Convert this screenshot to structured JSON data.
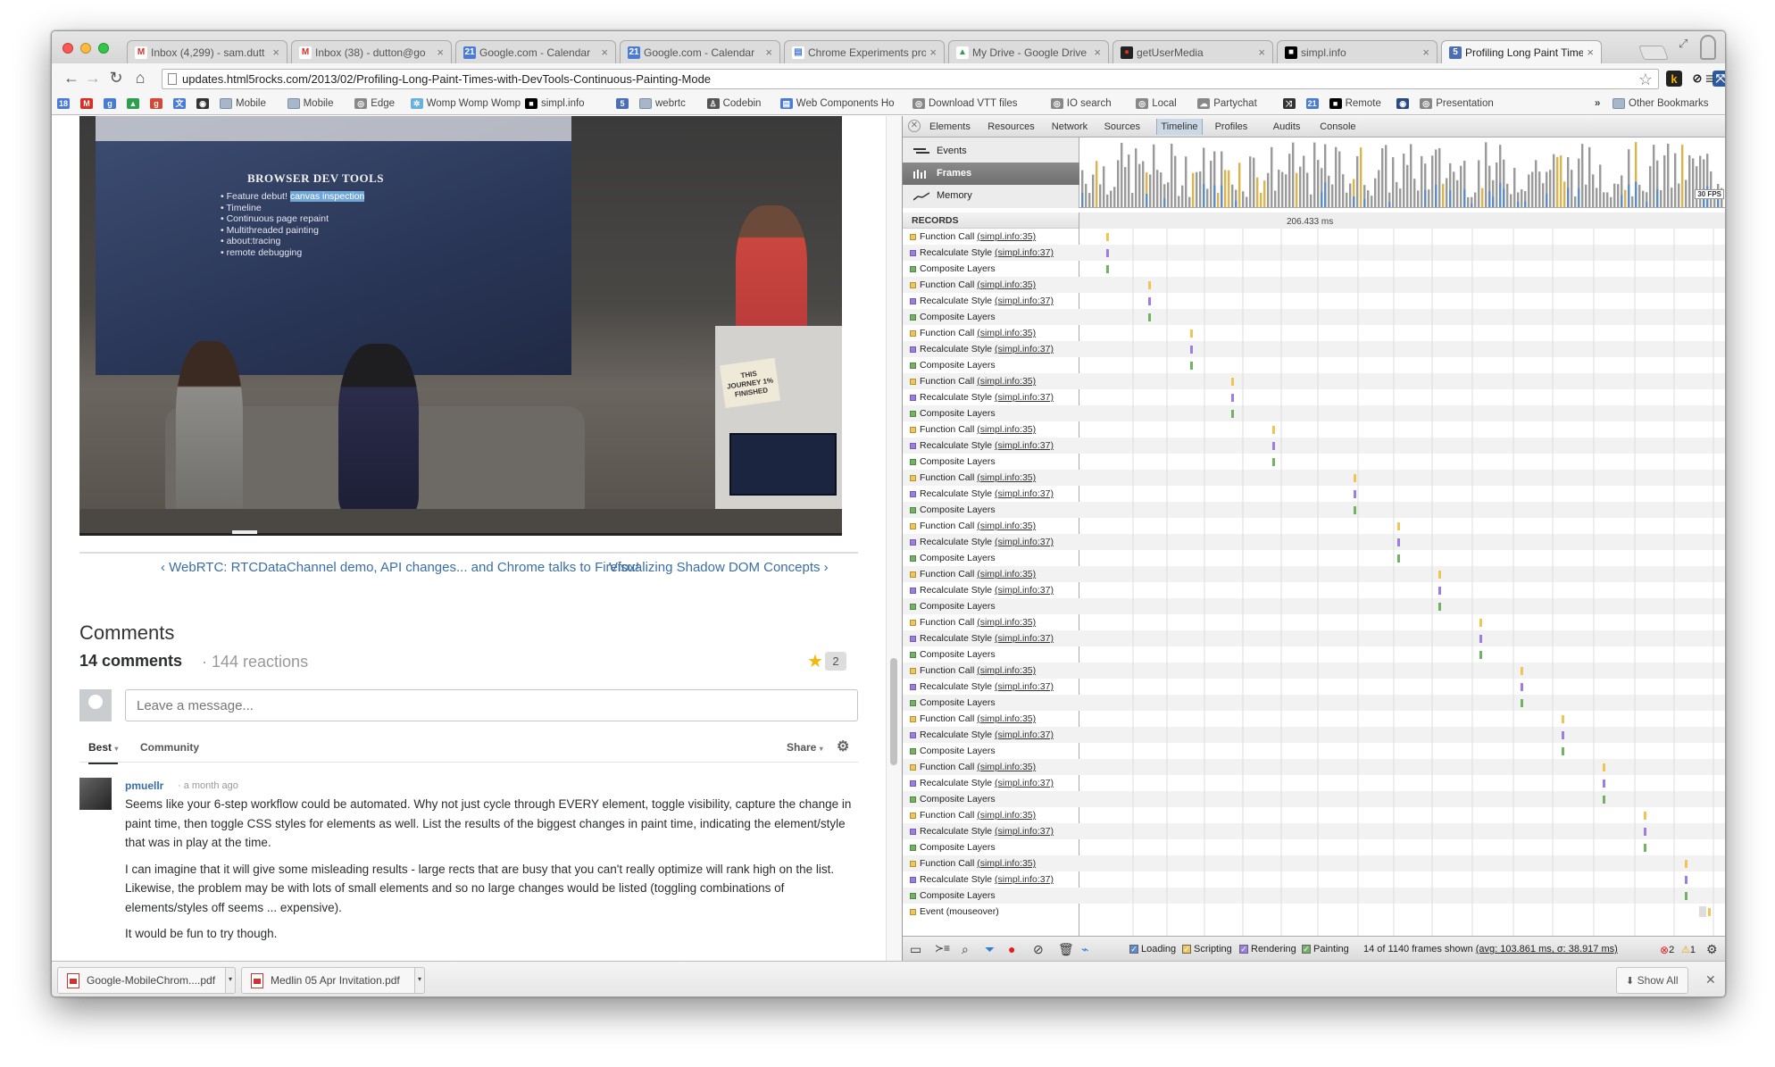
{
  "window": {
    "lights": [
      "#fc5753",
      "#fdbc40",
      "#33c748"
    ]
  },
  "tabs": [
    {
      "title": "Inbox (4,299) - sam.dutt",
      "icon": "gmail-icon",
      "fav": "M",
      "fav_color": "#d93025",
      "fav_bg": "#fff"
    },
    {
      "title": "Inbox (38) - dutton@go",
      "icon": "gmail-icon",
      "fav": "M",
      "fav_color": "#d93025",
      "fav_bg": "#fff"
    },
    {
      "title": "Google.com - Calendar",
      "icon": "calendar-icon",
      "fav": "21",
      "fav_color": "#fff",
      "fav_bg": "#4a7bd6"
    },
    {
      "title": "Google.com - Calendar",
      "icon": "calendar-icon",
      "fav": "21",
      "fav_color": "#fff",
      "fav_bg": "#4a7bd6"
    },
    {
      "title": "Chrome Experiments pro",
      "icon": "page-icon",
      "fav": "▤",
      "fav_color": "#4a7bd6",
      "fav_bg": "#fff"
    },
    {
      "title": "My Drive - Google Drive",
      "icon": "drive-icon",
      "fav": "▲",
      "fav_color": "#2e9e4f",
      "fav_bg": "#fff"
    },
    {
      "title": "getUserMedia",
      "icon": "record-icon",
      "fav": "●",
      "fav_color": "#d93025",
      "fav_bg": "#222"
    },
    {
      "title": "simpl.info",
      "icon": "simpl-icon",
      "fav": "■",
      "fav_color": "#fff",
      "fav_bg": "#000"
    },
    {
      "title": "Profiling Long Paint Time",
      "icon": "html5-icon",
      "fav": "5",
      "fav_color": "#fff",
      "fav_bg": "#4a6fb5"
    }
  ],
  "toolbar": {
    "url_host": "updates.html5rocks.com",
    "url_path": "/2013/02/Profiling-Long-Paint-Times-with-DevTools-Continuous-Painting-Mode"
  },
  "bookmarks": {
    "items": [
      {
        "label": "",
        "icon": "calendar-icon",
        "color": "#4a7bd6",
        "glyph": "18"
      },
      {
        "label": "",
        "icon": "gmail-icon",
        "color": "#d93025",
        "glyph": "M"
      },
      {
        "label": "",
        "icon": "google-icon",
        "color": "#4a7bd6",
        "glyph": "g"
      },
      {
        "label": "",
        "icon": "drive-icon",
        "color": "#2e9e4f",
        "glyph": "▲"
      },
      {
        "label": "",
        "icon": "gplus-icon",
        "color": "#d34836",
        "glyph": "g"
      },
      {
        "label": "",
        "icon": "translate-icon",
        "color": "#4a7bd6",
        "glyph": "文"
      },
      {
        "label": "",
        "icon": "globe-icon",
        "color": "#333",
        "glyph": "◉"
      },
      {
        "label": "Mobile",
        "icon": "folder-icon",
        "color": "#a7b7c9",
        "glyph": ""
      },
      {
        "label": "Mobile",
        "icon": "folder-icon",
        "color": "#a7b7c9",
        "glyph": ""
      },
      {
        "label": "Edge",
        "icon": "globe-icon",
        "color": "#888",
        "glyph": "◎"
      },
      {
        "label": "Womp Womp Womp",
        "icon": "gear-icon",
        "color": "#6ab0de",
        "glyph": "✲"
      },
      {
        "label": "simpl.info",
        "icon": "simpl-icon",
        "color": "#000",
        "glyph": "■"
      },
      {
        "label": "",
        "icon": "html5-icon",
        "color": "#4a6fb5",
        "glyph": "5"
      },
      {
        "label": "webrtc",
        "icon": "folder-icon",
        "color": "#a7b7c9",
        "glyph": ""
      },
      {
        "label": "Codebin",
        "icon": "person-icon",
        "color": "#555",
        "glyph": "♙"
      },
      {
        "label": "Web Components Ho",
        "icon": "page-icon",
        "color": "#4a7bd6",
        "glyph": "▤"
      },
      {
        "label": "Download VTT files",
        "icon": "globe-icon",
        "color": "#888",
        "glyph": "◎"
      },
      {
        "label": "IO search",
        "icon": "globe-icon",
        "color": "#888",
        "glyph": "◎"
      },
      {
        "label": "Local",
        "icon": "globe-icon",
        "color": "#888",
        "glyph": "◎"
      },
      {
        "label": "Partychat",
        "icon": "chat-icon",
        "color": "#888",
        "glyph": "☁"
      },
      {
        "label": "",
        "icon": "share-icon",
        "color": "#333",
        "glyph": "⤨"
      },
      {
        "label": "",
        "icon": "calendar-icon",
        "color": "#4a7bd6",
        "glyph": "21"
      },
      {
        "label": "Remote",
        "icon": "simpl-icon",
        "color": "#000",
        "glyph": "■"
      },
      {
        "label": "",
        "icon": "globe-icon",
        "color": "#2c4a80",
        "glyph": "◉"
      },
      {
        "label": "Presentation",
        "icon": "globe-icon",
        "color": "#888",
        "glyph": "◎"
      }
    ],
    "overflow": "»",
    "other": "Other Bookmarks"
  },
  "video": {
    "slide_title": "BROWSER DEV TOOLS",
    "slide_items": [
      "Feature debut! ",
      "Timeline",
      "Continuous page repaint",
      "Multithreaded painting",
      "about:tracing",
      "remote debugging"
    ],
    "slide_highlight": "canvas inspection",
    "sign_text": "THIS JOURNEY 1% FINISHED",
    "progress": 0.2
  },
  "post_nav": {
    "prev": "‹ WebRTC: RTCDataChannel demo, API changes... and Chrome talks to Firefox!",
    "next": "Visualizing Shadow DOM Concepts ›"
  },
  "comments": {
    "heading": "Comments",
    "count": "14 comments",
    "reactions": "· 144 reactions",
    "stars": "2",
    "placeholder": "Leave a message...",
    "sort": [
      "Best",
      "Community"
    ],
    "share": "Share",
    "items": [
      {
        "author": "pmuellr",
        "time": "· a month ago",
        "paragraphs": [
          "Seems like your 6-step workflow could be automated. Why not just cycle through EVERY element, toggle visibility, capture the change in paint time, then toggle CSS styles for elements as well. List the results of the biggest changes in paint time, indicating the element/style that was in play at the time.",
          "I can imagine that it will give some misleading results - large rects that are busy that you can't really optimize will rank high on the list. Likewise, the problem may be with lots of small elements and so no large changes would be listed (toggling combinations of elements/styles off seems ... expensive).",
          "It would be fun to try though."
        ]
      }
    ]
  },
  "devtools": {
    "tabs": [
      "Elements",
      "Resources",
      "Network",
      "Sources",
      "Timeline",
      "Profiles",
      "Audits",
      "Console"
    ],
    "active_tab": "Timeline",
    "overview_items": [
      "Events",
      "Frames",
      "Memory"
    ],
    "selected_overview": "Frames",
    "fps_label": "30 FPS",
    "records_header": "RECORDS",
    "time_label": "206.433 ms",
    "colors": {
      "scripting": "#f1c453",
      "rendering": "#9a7ee6",
      "painting": "#71b363",
      "loading": "#5a8ccf"
    },
    "groups": 14,
    "record_names": [
      "Function Call",
      "Recalculate Style",
      "Composite Layers"
    ],
    "record_links": [
      "(simpl.info:35)",
      "(simpl.info:37)",
      ""
    ],
    "record_kinds": [
      "scripting",
      "rendering",
      "painting"
    ],
    "last_record": "Event (mouseover)",
    "legend": [
      "Loading",
      "Scripting",
      "Rendering",
      "Painting"
    ],
    "frames_shown": "14 of 1140 frames shown",
    "avg_stats": "(avg: 103.861 ms, σ: 38.917 ms)",
    "errors": "2",
    "warnings": "1"
  },
  "downloads": {
    "files": [
      "Google-MobileChrom....pdf",
      "Medlin 05 Apr Invitation.pdf"
    ],
    "show_all": "Show All"
  }
}
